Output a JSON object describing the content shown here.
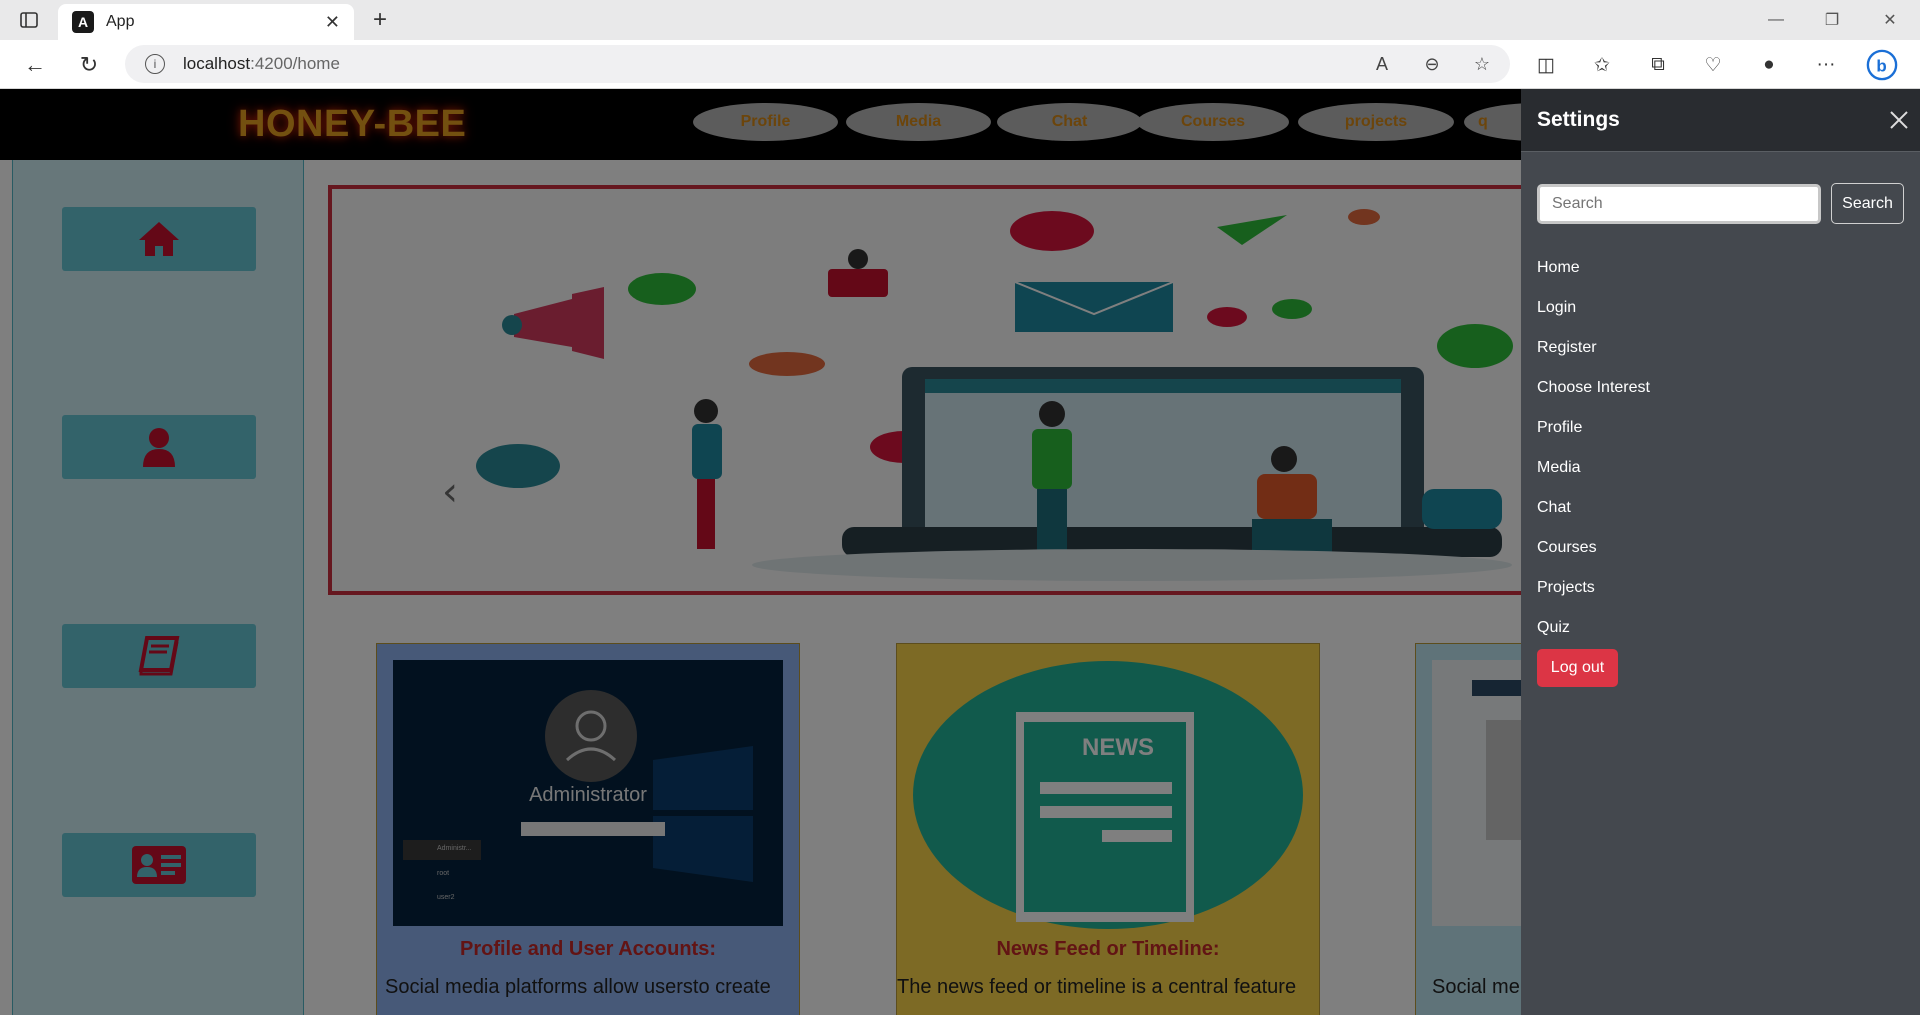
{
  "browser": {
    "tab_title": "App",
    "url_host": "localhost",
    "url_path": ":4200/home"
  },
  "app": {
    "brand": "HONEY-BEE",
    "nav_items": [
      "Profile",
      "Media",
      "Chat",
      "Courses",
      "projects",
      "q"
    ],
    "sidebar_icons": [
      "home-icon",
      "user-icon",
      "book-icon",
      "id-card-icon"
    ]
  },
  "cards": [
    {
      "title": "Profile and User Accounts:",
      "text": "Social media platforms allow usersto create",
      "image_text": "Administrator",
      "login_users": [
        "Administr...",
        "root",
        "user2"
      ]
    },
    {
      "title": "News Feed or Timeline:",
      "text": "The news feed or timeline is a central feature",
      "image_text": "NEWS"
    },
    {
      "title": "",
      "text": "Social me"
    }
  ],
  "offcanvas": {
    "title": "Settings",
    "search_placeholder": "Search",
    "search_button": "Search",
    "links": [
      "Home",
      "Login",
      "Register",
      "Choose Interest",
      "Profile",
      "Media",
      "Chat",
      "Courses",
      "Projects",
      "Quiz"
    ],
    "logout_label": "Log out"
  },
  "colors": {
    "brand": "#e6a020",
    "danger": "#dc3545",
    "sidebar": "#67c6d4",
    "offcanvas_bg": "#44484e"
  }
}
